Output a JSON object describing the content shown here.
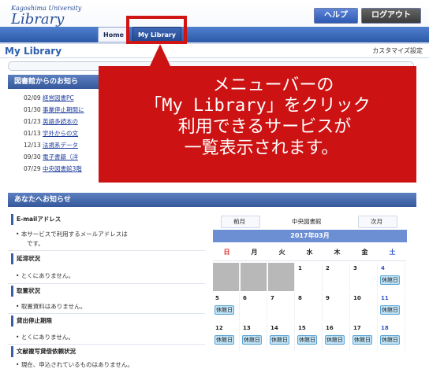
{
  "header": {
    "logo_university": "Kagoshima University",
    "logo_library": "Library",
    "help_label": "ヘルプ",
    "logout_label": "ログアウト",
    "tab_home": "Home",
    "tab_mylibrary": "My Library"
  },
  "title_bar": {
    "title": "My Library",
    "customize": "カスタマイズ設定"
  },
  "library_news": {
    "heading": "図書館からのお知ら",
    "items": [
      {
        "date": "02/09",
        "text": "経営図書PC"
      },
      {
        "date": "01/30",
        "text": "事業停止期間に"
      },
      {
        "date": "01/23",
        "text": "英語多読本の"
      },
      {
        "date": "01/13",
        "text": "学外からの文"
      },
      {
        "date": "12/13",
        "text": "法規系データ"
      },
      {
        "date": "09/30",
        "text": "電子書籍（洋"
      },
      {
        "date": "07/29",
        "text": "中央図書館3階"
      }
    ]
  },
  "callout": {
    "line1": "メニューバーの",
    "line2": "「My Library」をクリック",
    "line3": "利用できるサービスが",
    "line4": "一覧表示されます。"
  },
  "notices": {
    "heading": "あなたへお知らせ",
    "sections": [
      {
        "title": "E-mailアドレス",
        "items": [
          "本サービスで利用するメールアドレスは",
          "です。"
        ]
      },
      {
        "title": "延滞状況",
        "items": [
          "とくにありません。"
        ]
      },
      {
        "title": "取置状況",
        "items": [
          "取置資料はありません。"
        ]
      },
      {
        "title": "貸出停止期限",
        "items": [
          "とくにありません。"
        ]
      },
      {
        "title": "文献複写貸借依頼状況",
        "items": [
          "現在、申込されているものはありません。"
        ]
      }
    ]
  },
  "calendar": {
    "prev": "前月",
    "library": "中央図書館",
    "next": "次月",
    "month": "2017年03月",
    "days": [
      "日",
      "月",
      "火",
      "水",
      "木",
      "金",
      "土"
    ],
    "closed_label": "休館日",
    "weeks": [
      [
        "",
        "",
        "",
        "1",
        "2",
        "3",
        "4"
      ],
      [
        "5",
        "6",
        "7",
        "8",
        "9",
        "10",
        "11"
      ],
      [
        "12",
        "13",
        "14",
        "15",
        "16",
        "17",
        "18"
      ]
    ],
    "closed_days": [
      "4",
      "5",
      "11",
      "12",
      "13",
      "14",
      "15",
      "16",
      "17",
      "18"
    ]
  },
  "colors": {
    "accent": "#2e5fae",
    "callout_red": "#cc1212",
    "calendar_header": "#6c8fd3"
  }
}
